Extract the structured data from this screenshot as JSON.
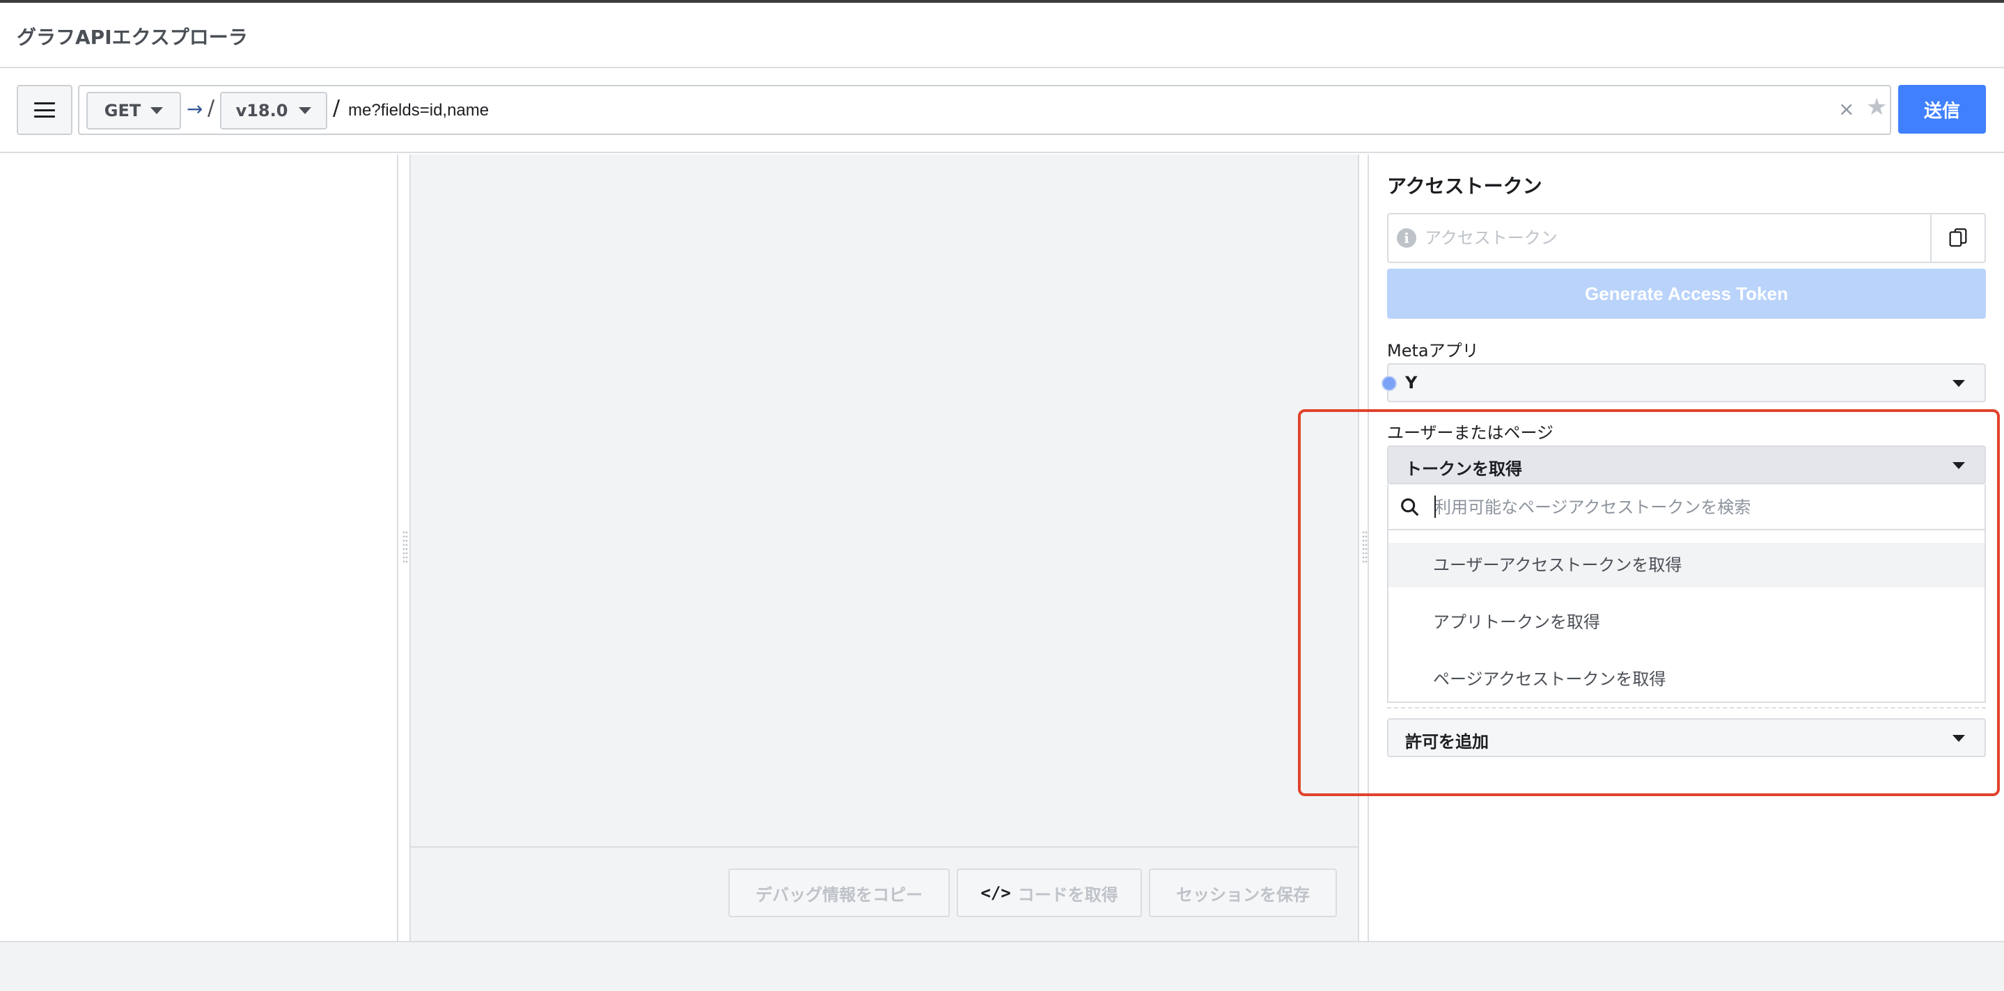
{
  "header": {
    "title": "グラフAPIエクスプローラ"
  },
  "query": {
    "method": "GET",
    "version": "v18.0",
    "path_value": "me?fields=id,name",
    "submit_label": "送信",
    "clear_glyph": "×",
    "star_glyph": "★",
    "arrow_glyph": "→",
    "slash": "/"
  },
  "center_footer": {
    "copy_debug_label": "デバッグ情報をコピー",
    "get_code_label": "コードを取得",
    "code_glyph": "</>",
    "save_session_label": "セッションを保存"
  },
  "access_token": {
    "title": "アクセストークン",
    "placeholder": "アクセストークン",
    "generate_label": "Generate Access Token",
    "info_glyph": "i"
  },
  "meta_app": {
    "label": "Metaアプリ",
    "selected": "Y"
  },
  "user_or_page": {
    "label": "ユーザーまたはページ",
    "selected": "トークンを取得",
    "search_placeholder": "利用可能なページアクセストークンを検索",
    "options": [
      "ユーザーアクセストークンを取得",
      "アプリトークンを取得",
      "ページアクセストークンを取得"
    ]
  },
  "permissions": {
    "label": "許可を追加"
  },
  "colors": {
    "accent": "#4080ff",
    "generate_disabled": "#b9d3fb",
    "highlight": "#e0432d",
    "app_dot": "#7aa2f7"
  }
}
